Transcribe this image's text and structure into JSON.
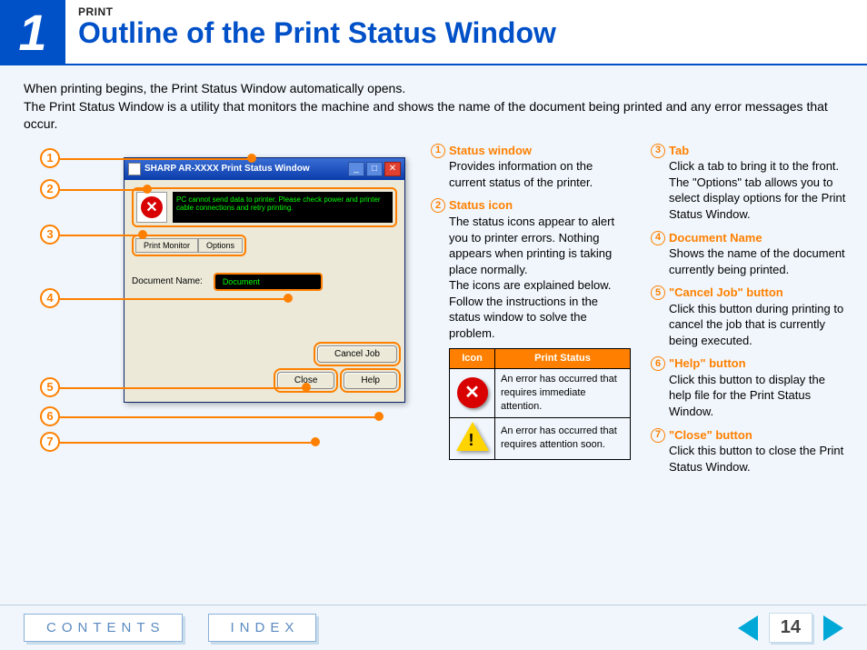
{
  "chapter_number": "1",
  "section_label": "PRINT",
  "page_title": "Outline of the Print Status Window",
  "intro_line1": "When printing begins, the Print Status Window automatically opens.",
  "intro_line2": "The Print Status Window is a utility that monitors the machine and shows the name of the document being printed and any error messages that occur.",
  "window": {
    "title": "SHARP AR-XXXX Print Status Window",
    "status_message": "PC cannot send data to printer. Please check power and printer cable connections and retry printing.",
    "tab1": "Print Monitor",
    "tab2": "Options",
    "docname_label": "Document Name:",
    "docname_value": "Document",
    "cancel_btn": "Cancel Job",
    "close_btn": "Close",
    "help_btn": "Help"
  },
  "callouts": [
    "1",
    "2",
    "3",
    "4",
    "5",
    "6",
    "7"
  ],
  "items": [
    {
      "num": "1",
      "title": "Status window",
      "body": "Provides information on the current status of the printer."
    },
    {
      "num": "2",
      "title": "Status icon",
      "body": "The status icons appear to alert you to printer errors. Nothing appears when printing is taking place normally.\nThe icons are explained below. Follow the instructions in the status window to solve the problem."
    },
    {
      "num": "3",
      "title": "Tab",
      "body": "Click a tab to bring it to the front. The \"Options\" tab allows you to select display options for the Print Status Window."
    },
    {
      "num": "4",
      "title": "Document Name",
      "body": "Shows the name of the document currently being printed."
    },
    {
      "num": "5",
      "title": "\"Cancel Job\" button",
      "body": "Click this button during printing to cancel the job that is currently being executed."
    },
    {
      "num": "6",
      "title": "\"Help\" button",
      "body": "Click this button to display the help file for the Print Status Window."
    },
    {
      "num": "7",
      "title": "\"Close\" button",
      "body": "Click this button to close the Print Status Window."
    }
  ],
  "icon_table": {
    "head_icon": "Icon",
    "head_status": "Print Status",
    "row1": "An error has occurred that requires immediate attention.",
    "row2": "An error has occurred that requires attention soon."
  },
  "footer": {
    "contents": "CONTENTS",
    "index": "INDEX",
    "page": "14"
  }
}
